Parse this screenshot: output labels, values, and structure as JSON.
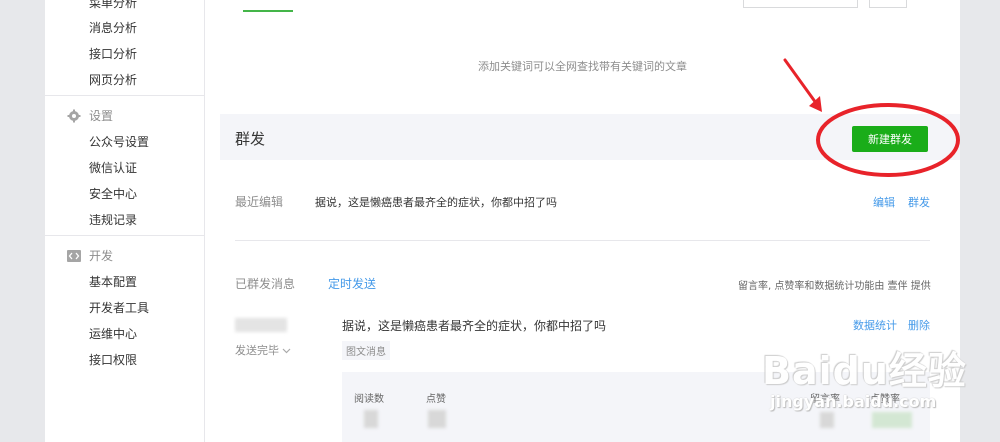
{
  "sidebar": {
    "top_items": [
      "菜单分析",
      "消息分析",
      "接口分析",
      "网页分析"
    ],
    "groups": [
      {
        "label": "设置",
        "icon": "gear-icon",
        "items": [
          "公众号设置",
          "微信认证",
          "安全中心",
          "违规记录"
        ]
      },
      {
        "label": "开发",
        "icon": "code-icon",
        "items": [
          "基本配置",
          "开发者工具",
          "运维中心",
          "接口权限"
        ]
      }
    ]
  },
  "main": {
    "keyword_hint": "添加关键词可以全网查找带有关键词的文章",
    "section_title": "群发",
    "new_button": "新建群发",
    "recent": {
      "label": "最近编辑",
      "text": "据说，这是懒癌患者最齐全的症状，你都中招了吗",
      "edit": "编辑",
      "send": "群发"
    },
    "tabs": {
      "sent": "已群发消息",
      "scheduled": "定时发送"
    },
    "stat_note": "留言率, 点赞率和数据统计功能由 壹伴 提供",
    "message": {
      "status": "发送完毕",
      "title": "据说，这是懒癌患者最齐全的症状，你都中招了吗",
      "tag": "图文消息",
      "stats_link": "数据统计",
      "delete": "删除",
      "stat_labels": {
        "reads": "阅读数",
        "likes": "点赞",
        "comment_rate": "留言率",
        "like_rate": "点赞率"
      }
    }
  },
  "watermark": {
    "brand": "Baidu经验",
    "url": "jingyan.baidu.com"
  },
  "colors": {
    "primary_green": "#1aad19",
    "link_blue": "#459ae9",
    "annotation_red": "#e8232a"
  }
}
